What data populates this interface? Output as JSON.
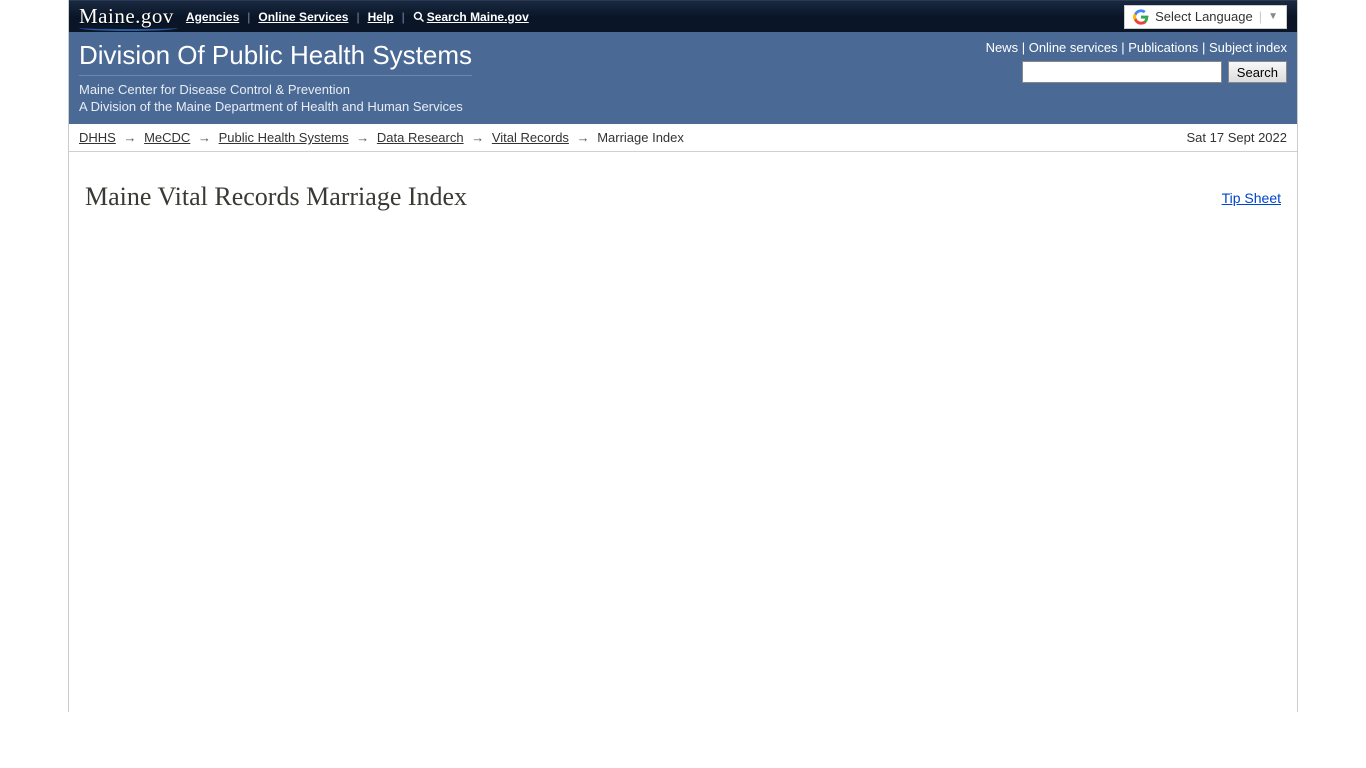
{
  "topbar": {
    "logo_text": "Maine.gov",
    "links": {
      "agencies": "Agencies",
      "online_services": "Online Services",
      "help": "Help",
      "search": "Search Maine.gov"
    },
    "language": {
      "label": "Select Language"
    }
  },
  "header": {
    "title": "Division Of Public Health Systems",
    "subtitle1": "Maine Center for Disease Control & Prevention",
    "subtitle2": "A Division of the Maine Department of Health and Human Services",
    "nav": {
      "news": "News",
      "online_services": "Online services",
      "publications": "Publications",
      "subject_index": "Subject index"
    },
    "search_button": "Search"
  },
  "breadcrumb": {
    "items": [
      {
        "label": "DHHS",
        "link": true
      },
      {
        "label": "MeCDC",
        "link": true
      },
      {
        "label": "Public Health Systems",
        "link": true
      },
      {
        "label": "Data Research",
        "link": true
      },
      {
        "label": "Vital Records",
        "link": true
      },
      {
        "label": "Marriage Index",
        "link": false
      }
    ],
    "date": "Sat 17 Sept 2022"
  },
  "main": {
    "title": "Maine Vital Records Marriage Index",
    "tip_sheet": "Tip Sheet"
  }
}
